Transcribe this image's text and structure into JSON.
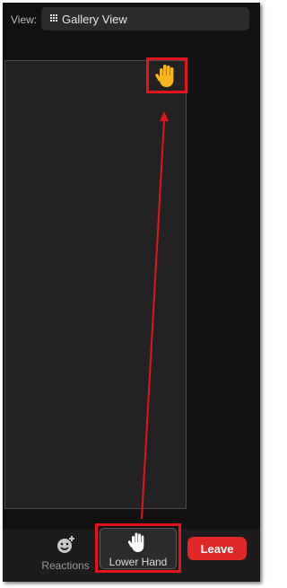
{
  "header": {
    "view_label": "View:",
    "view_value": "Gallery View"
  },
  "toolbar": {
    "reactions_label": "Reactions",
    "lower_hand_label": "Lower Hand",
    "leave_label": "Leave"
  },
  "colors": {
    "annotation_red": "#e3141b",
    "leave_red": "#e02828",
    "raised_hand_yellow": "#f5b71c"
  },
  "icons": [
    "grid-icon",
    "raised-hand-icon",
    "reactions-icon",
    "hand-icon"
  ]
}
